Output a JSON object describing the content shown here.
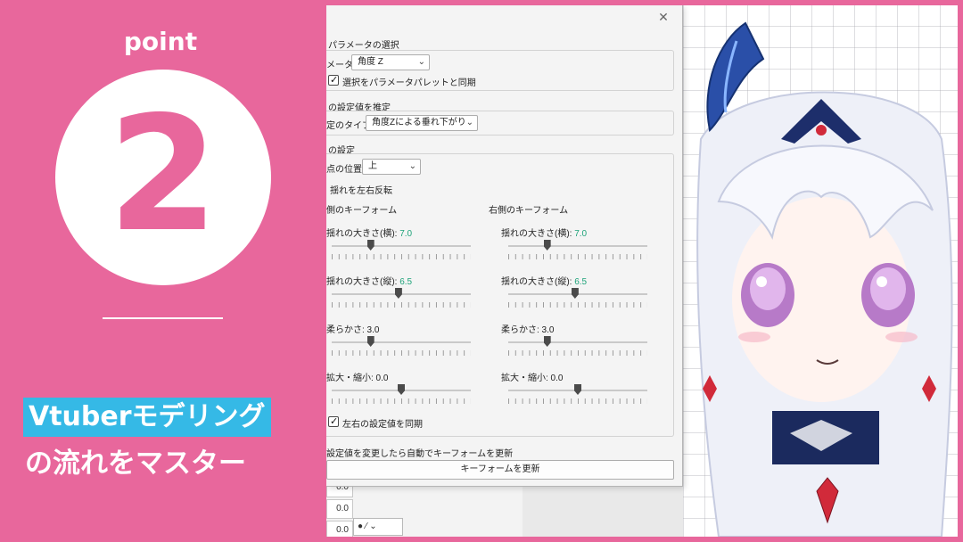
{
  "promo": {
    "point_label": "point",
    "number": "2",
    "title_line1": "Vtuberモデリング",
    "title_line2": "の流れをマスター"
  },
  "colors": {
    "background": "#e8679c",
    "highlight": "#35b9e6",
    "value_text": "#1fa37a"
  },
  "dialog": {
    "close_icon": "close-icon",
    "param_section": {
      "title": "パラメータの選択",
      "param_label": "メータ",
      "param_value": "角度 Z",
      "sync_label": "選択をパラメータパレットと同期",
      "sync_checked": true
    },
    "estimate_section": {
      "title": "の設定値を推定",
      "type_label": "定のタイプ",
      "type_value": "角度Zによる垂れ下がり"
    },
    "settings_section": {
      "title": "の設定",
      "position_label": "点の位置",
      "position_value": "上",
      "flip_label": "揺れを左右反転",
      "left_keyform_label": "側のキーフォーム",
      "right_keyform_label": "右側のキーフォーム",
      "left": {
        "h_label": "揺れの大きさ(横): ",
        "h_value": "7.0",
        "h_level": 0.28,
        "v_label": "揺れの大きさ(縦): ",
        "v_value": "6.5",
        "v_level": 0.48,
        "soft_label": "柔らかさ: 3.0",
        "soft_level": 0.28,
        "scale_label": "拡大・縮小: 0.0",
        "scale_level": 0.5
      },
      "right": {
        "h_label": "揺れの大きさ(横): ",
        "h_value": "7.0",
        "h_level": 0.28,
        "v_label": "揺れの大きさ(縦): ",
        "v_value": "6.5",
        "v_level": 0.48,
        "soft_label": "柔らかさ: 3.0",
        "soft_level": 0.28,
        "scale_label": "拡大・縮小: 0.0",
        "scale_level": 0.5
      },
      "sync_lr_label": "左右の設定値を同期",
      "sync_lr_checked": true
    },
    "auto_update_label": "設定値を変更したら自動でキーフォームを更新",
    "update_button": "キーフォームを更新"
  },
  "bottom": {
    "rows": [
      "0.0",
      "0.0",
      "0.0"
    ]
  }
}
